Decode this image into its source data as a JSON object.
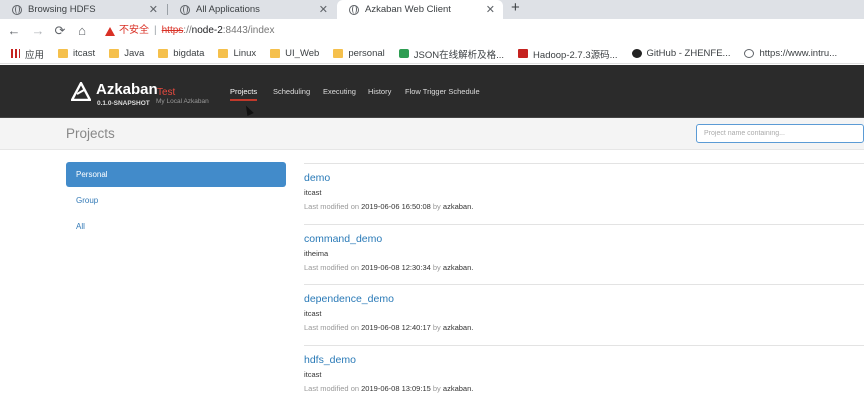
{
  "browser": {
    "tabs": [
      {
        "title": "Browsing HDFS",
        "active": false
      },
      {
        "title": "All Applications",
        "active": false
      },
      {
        "title": "Azkaban Web Client",
        "active": true
      }
    ],
    "new_tab": "+",
    "nav": {
      "back": "←",
      "forward": "→",
      "reload": "⟳",
      "home": "⌂"
    },
    "address": {
      "security_label": "不安全",
      "scheme": "https",
      "separator": "://",
      "host": "node-2",
      "rest": ":8443/index"
    },
    "bookmarks": [
      {
        "label": "应用",
        "icon": "apps-grid-icon"
      },
      {
        "label": "itcast",
        "icon": "folder-icon"
      },
      {
        "label": "Java",
        "icon": "folder-icon"
      },
      {
        "label": "bigdata",
        "icon": "folder-icon"
      },
      {
        "label": "Linux",
        "icon": "folder-icon"
      },
      {
        "label": "UI_Web",
        "icon": "folder-icon"
      },
      {
        "label": "personal",
        "icon": "folder-icon"
      },
      {
        "label": "JSON在线解析及格...",
        "icon": "json-icon"
      },
      {
        "label": "Hadoop-2.7.3源码...",
        "icon": "hadoop-icon"
      },
      {
        "label": "GitHub - ZHENFE...",
        "icon": "github-icon"
      },
      {
        "label": "https://www.intru...",
        "icon": "globe-icon"
      }
    ]
  },
  "app": {
    "logo": {
      "name": "Azkaban",
      "env": "Test",
      "version": "0.1.0-SNAPSHOT",
      "subtitle": "My Local Azkaban"
    },
    "nav": [
      {
        "label": "Projects",
        "active": true
      },
      {
        "label": "Scheduling",
        "active": false
      },
      {
        "label": "Executing",
        "active": false
      },
      {
        "label": "History",
        "active": false
      },
      {
        "label": "Flow Trigger Schedule",
        "active": false
      }
    ],
    "page_title": "Projects",
    "search_placeholder": "Project name containing...",
    "filters": [
      {
        "label": "Personal",
        "active": true
      },
      {
        "label": "Group",
        "active": false
      },
      {
        "label": "All",
        "active": false
      }
    ],
    "projects": [
      {
        "name": "demo",
        "description": "itcast",
        "modified_prefix": "Last modified on",
        "modified": "2019-06-06 16:50:08",
        "by": "by",
        "user": "azkaban."
      },
      {
        "name": "command_demo",
        "description": "itheima",
        "modified_prefix": "Last modified on",
        "modified": "2019-06-08 12:30:34",
        "by": "by",
        "user": "azkaban."
      },
      {
        "name": "dependence_demo",
        "description": "itcast",
        "modified_prefix": "Last modified on",
        "modified": "2019-06-08 12:40:17",
        "by": "by",
        "user": "azkaban."
      },
      {
        "name": "hdfs_demo",
        "description": "itcast",
        "modified_prefix": "Last modified on",
        "modified": "2019-06-08 13:09:15",
        "by": "by",
        "user": "azkaban."
      }
    ]
  }
}
